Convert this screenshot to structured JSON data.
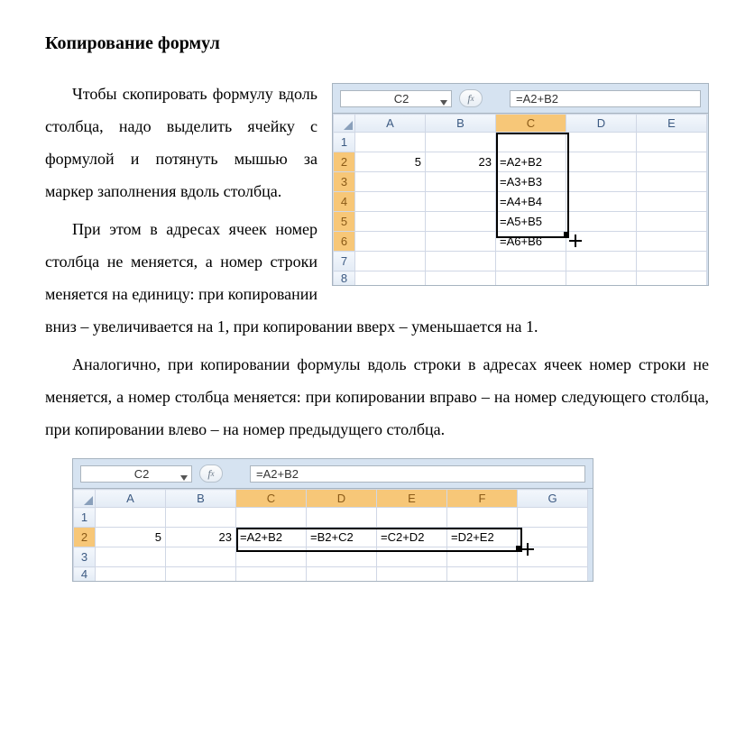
{
  "title": "Копирование формул",
  "para1a": "Чтобы скопировать формулу вдоль столбца, надо выделить ячейку с формулой и потянуть мышью за маркер заполнения вдоль столбца.",
  "para1b": "При этом в адресах ячеек номер столбца не меняется, а номер строки меняется на единицу: при копировании вниз – увеличивается на 1, при копировании вверх – уменьшается на 1.",
  "para2": "Аналогично, при копировании формулы вдоль строки в адресах ячеек номер строки не меняется, а номер столбца меняется: при копировании вправо – на номер следующего столбца, при копировании влево – на номер предыдущего столбца.",
  "excel1": {
    "name_box": "C2",
    "formula": "=A2+B2",
    "cols": [
      "A",
      "B",
      "C",
      "D",
      "E"
    ],
    "rows": [
      "1",
      "2",
      "3",
      "4",
      "5",
      "6",
      "7",
      "8"
    ],
    "a2": "5",
    "b2": "23",
    "c2": "=A2+B2",
    "c3": "=A3+B3",
    "c4": "=A4+B4",
    "c5": "=A5+B5",
    "c6": "=A6+B6"
  },
  "excel2": {
    "name_box": "C2",
    "formula": "=A2+B2",
    "cols": [
      "A",
      "B",
      "C",
      "D",
      "E",
      "F",
      "G"
    ],
    "rows": [
      "1",
      "2",
      "3",
      "4"
    ],
    "a2": "5",
    "b2": "23",
    "c2": "=A2+B2",
    "d2": "=B2+C2",
    "e2": "=C2+D2",
    "f2": "=D2+E2"
  }
}
